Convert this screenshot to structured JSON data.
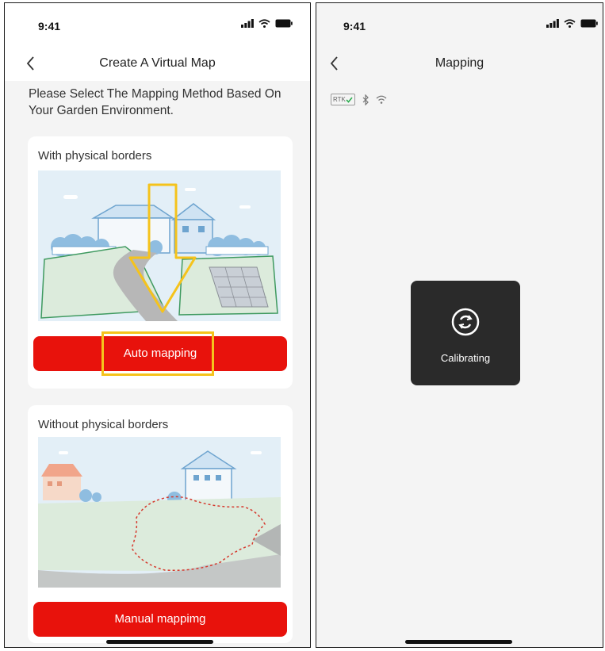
{
  "left_screen": {
    "status_time": "9:41",
    "nav_title": "Create A Virtual Map",
    "instruction": "Please Select The Mapping Method Based On Your Garden Environment.",
    "auto_card": {
      "title": "With physical borders",
      "button_label": "Auto mapping"
    },
    "manual_card": {
      "title": "Without physical borders",
      "button_label": "Manual mappimg"
    }
  },
  "right_screen": {
    "status_time": "9:41",
    "nav_title": "Mapping",
    "rtk_label": "RTK",
    "toast_text": "Calibrating"
  },
  "colors": {
    "accent": "#e8120c",
    "highlight": "#f5c31c",
    "toast_bg": "#2a2a2a"
  },
  "icons": [
    "back-chevron-icon",
    "signal-icon",
    "wifi-icon",
    "battery-icon",
    "bluetooth-icon",
    "check-icon",
    "calibrate-icon"
  ]
}
